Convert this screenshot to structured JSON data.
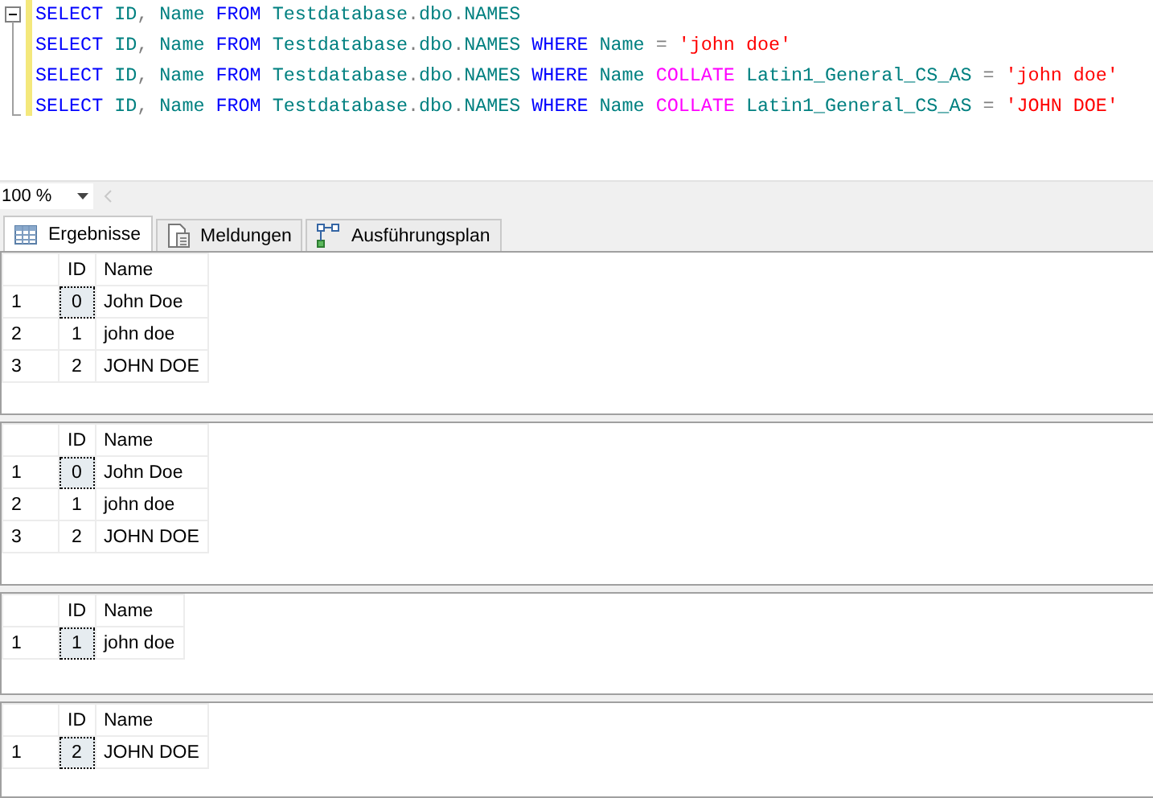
{
  "editor": {
    "lines": [
      [
        {
          "kind": "keyword",
          "text": "SELECT "
        },
        {
          "kind": "ident",
          "text": "ID"
        },
        {
          "kind": "op",
          "text": ", "
        },
        {
          "kind": "ident",
          "text": "Name "
        },
        {
          "kind": "keyword",
          "text": "FROM "
        },
        {
          "kind": "ident",
          "text": "Testdatabase"
        },
        {
          "kind": "op",
          "text": "."
        },
        {
          "kind": "ident",
          "text": "dbo"
        },
        {
          "kind": "op",
          "text": "."
        },
        {
          "kind": "ident",
          "text": "NAMES"
        }
      ],
      [
        {
          "kind": "keyword",
          "text": "SELECT "
        },
        {
          "kind": "ident",
          "text": "ID"
        },
        {
          "kind": "op",
          "text": ", "
        },
        {
          "kind": "ident",
          "text": "Name "
        },
        {
          "kind": "keyword",
          "text": "FROM "
        },
        {
          "kind": "ident",
          "text": "Testdatabase"
        },
        {
          "kind": "op",
          "text": "."
        },
        {
          "kind": "ident",
          "text": "dbo"
        },
        {
          "kind": "op",
          "text": "."
        },
        {
          "kind": "ident",
          "text": "NAMES "
        },
        {
          "kind": "keyword",
          "text": "WHERE "
        },
        {
          "kind": "ident",
          "text": "Name "
        },
        {
          "kind": "op",
          "text": "= "
        },
        {
          "kind": "string",
          "text": "'john doe'"
        }
      ],
      [
        {
          "kind": "keyword",
          "text": "SELECT "
        },
        {
          "kind": "ident",
          "text": "ID"
        },
        {
          "kind": "op",
          "text": ", "
        },
        {
          "kind": "ident",
          "text": "Name "
        },
        {
          "kind": "keyword",
          "text": "FROM "
        },
        {
          "kind": "ident",
          "text": "Testdatabase"
        },
        {
          "kind": "op",
          "text": "."
        },
        {
          "kind": "ident",
          "text": "dbo"
        },
        {
          "kind": "op",
          "text": "."
        },
        {
          "kind": "ident",
          "text": "NAMES "
        },
        {
          "kind": "keyword",
          "text": "WHERE "
        },
        {
          "kind": "ident",
          "text": "Name "
        },
        {
          "kind": "func",
          "text": "COLLATE "
        },
        {
          "kind": "ident",
          "text": "Latin1_General_CS_AS "
        },
        {
          "kind": "op",
          "text": "= "
        },
        {
          "kind": "string",
          "text": "'john doe'"
        }
      ],
      [
        {
          "kind": "keyword",
          "text": "SELECT "
        },
        {
          "kind": "ident",
          "text": "ID"
        },
        {
          "kind": "op",
          "text": ", "
        },
        {
          "kind": "ident",
          "text": "Name "
        },
        {
          "kind": "keyword",
          "text": "FROM "
        },
        {
          "kind": "ident",
          "text": "Testdatabase"
        },
        {
          "kind": "op",
          "text": "."
        },
        {
          "kind": "ident",
          "text": "dbo"
        },
        {
          "kind": "op",
          "text": "."
        },
        {
          "kind": "ident",
          "text": "NAMES "
        },
        {
          "kind": "keyword",
          "text": "WHERE "
        },
        {
          "kind": "ident",
          "text": "Name "
        },
        {
          "kind": "func",
          "text": "COLLATE "
        },
        {
          "kind": "ident",
          "text": "Latin1_General_CS_AS "
        },
        {
          "kind": "op",
          "text": "= "
        },
        {
          "kind": "string",
          "text": "'JOHN DOE'"
        }
      ]
    ]
  },
  "zoom": {
    "value": "100 %"
  },
  "tabs": [
    {
      "label": "Ergebnisse",
      "kind": "grid",
      "selected": true
    },
    {
      "label": "Meldungen",
      "kind": "document",
      "selected": false
    },
    {
      "label": "Ausführungsplan",
      "kind": "plan",
      "selected": false
    }
  ],
  "results": [
    {
      "columns": [
        "ID",
        "Name"
      ],
      "rows": [
        {
          "number": "1",
          "cells": [
            "0",
            "John Doe"
          ],
          "selected": true
        },
        {
          "number": "2",
          "cells": [
            "1",
            "john doe"
          ],
          "selected": false
        },
        {
          "number": "3",
          "cells": [
            "2",
            "JOHN DOE"
          ],
          "selected": false
        }
      ]
    },
    {
      "columns": [
        "ID",
        "Name"
      ],
      "rows": [
        {
          "number": "1",
          "cells": [
            "0",
            "John Doe"
          ],
          "selected": true
        },
        {
          "number": "2",
          "cells": [
            "1",
            "john doe"
          ],
          "selected": false
        },
        {
          "number": "3",
          "cells": [
            "2",
            "JOHN DOE"
          ],
          "selected": false
        }
      ]
    },
    {
      "columns": [
        "ID",
        "Name"
      ],
      "rows": [
        {
          "number": "1",
          "cells": [
            "1",
            "john doe"
          ],
          "selected": true
        }
      ]
    },
    {
      "columns": [
        "ID",
        "Name"
      ],
      "rows": [
        {
          "number": "1",
          "cells": [
            "2",
            "JOHN DOE"
          ],
          "selected": true
        }
      ]
    }
  ]
}
